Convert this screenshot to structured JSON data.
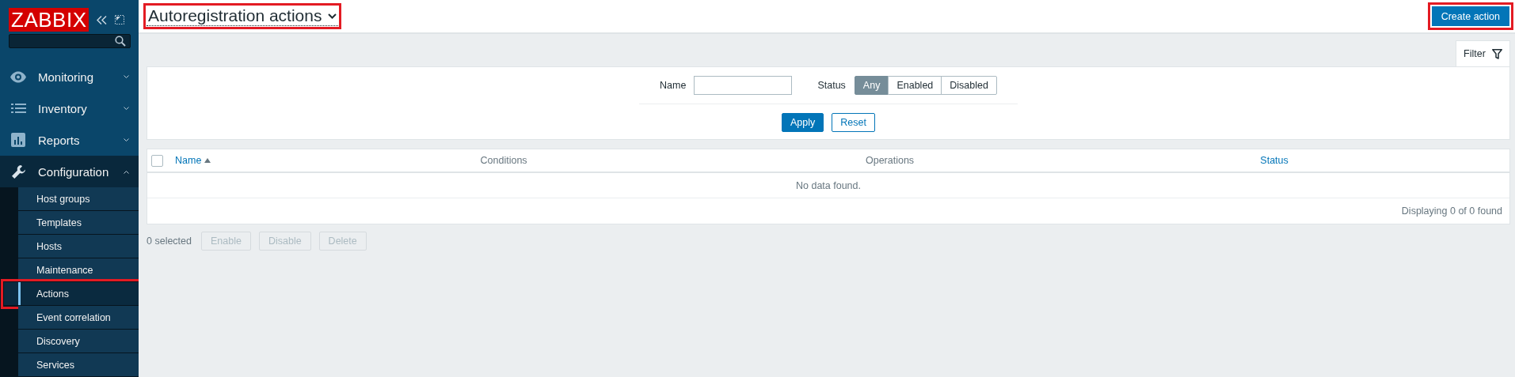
{
  "sidebar": {
    "logo": "ZABBIX",
    "menu": [
      {
        "label": "Monitoring",
        "kind": "eye",
        "expanded": false
      },
      {
        "label": "Inventory",
        "kind": "list",
        "expanded": false
      },
      {
        "label": "Reports",
        "kind": "chart",
        "expanded": false
      },
      {
        "label": "Configuration",
        "kind": "wrench",
        "expanded": true,
        "children": [
          {
            "label": "Host groups",
            "selected": false,
            "highlighted": false
          },
          {
            "label": "Templates",
            "selected": false,
            "highlighted": false
          },
          {
            "label": "Hosts",
            "selected": false,
            "highlighted": false
          },
          {
            "label": "Maintenance",
            "selected": false,
            "highlighted": false
          },
          {
            "label": "Actions",
            "selected": true,
            "highlighted": true
          },
          {
            "label": "Event correlation",
            "selected": false,
            "highlighted": false
          },
          {
            "label": "Discovery",
            "selected": false,
            "highlighted": false
          },
          {
            "label": "Services",
            "selected": false,
            "highlighted": false
          }
        ]
      }
    ]
  },
  "header": {
    "title": "Autoregistration actions",
    "highlighted": true,
    "create_button": {
      "label": "Create action",
      "highlighted": true
    }
  },
  "filter": {
    "tab": "Filter",
    "name_label": "Name",
    "status_label": "Status",
    "status_options": [
      {
        "label": "Any",
        "selected": true
      },
      {
        "label": "Enabled",
        "selected": false
      },
      {
        "label": "Disabled",
        "selected": false
      }
    ],
    "apply": "Apply",
    "reset": "Reset"
  },
  "table": {
    "select_all": {
      "checked": false
    },
    "columns": [
      {
        "label": "Name",
        "sorted": true,
        "link": true
      },
      {
        "label": "Conditions",
        "sorted": false,
        "link": false
      },
      {
        "label": "Operations",
        "sorted": false,
        "link": false
      },
      {
        "label": "Status",
        "sorted": false,
        "link": true
      }
    ],
    "empty": "No data found.",
    "footer": "Displaying 0 of 0 found"
  },
  "actions": {
    "selected_count": "0 selected",
    "buttons": [
      {
        "label": "Enable",
        "disabled": true
      },
      {
        "label": "Disable",
        "disabled": true
      },
      {
        "label": "Delete",
        "disabled": true
      }
    ]
  }
}
